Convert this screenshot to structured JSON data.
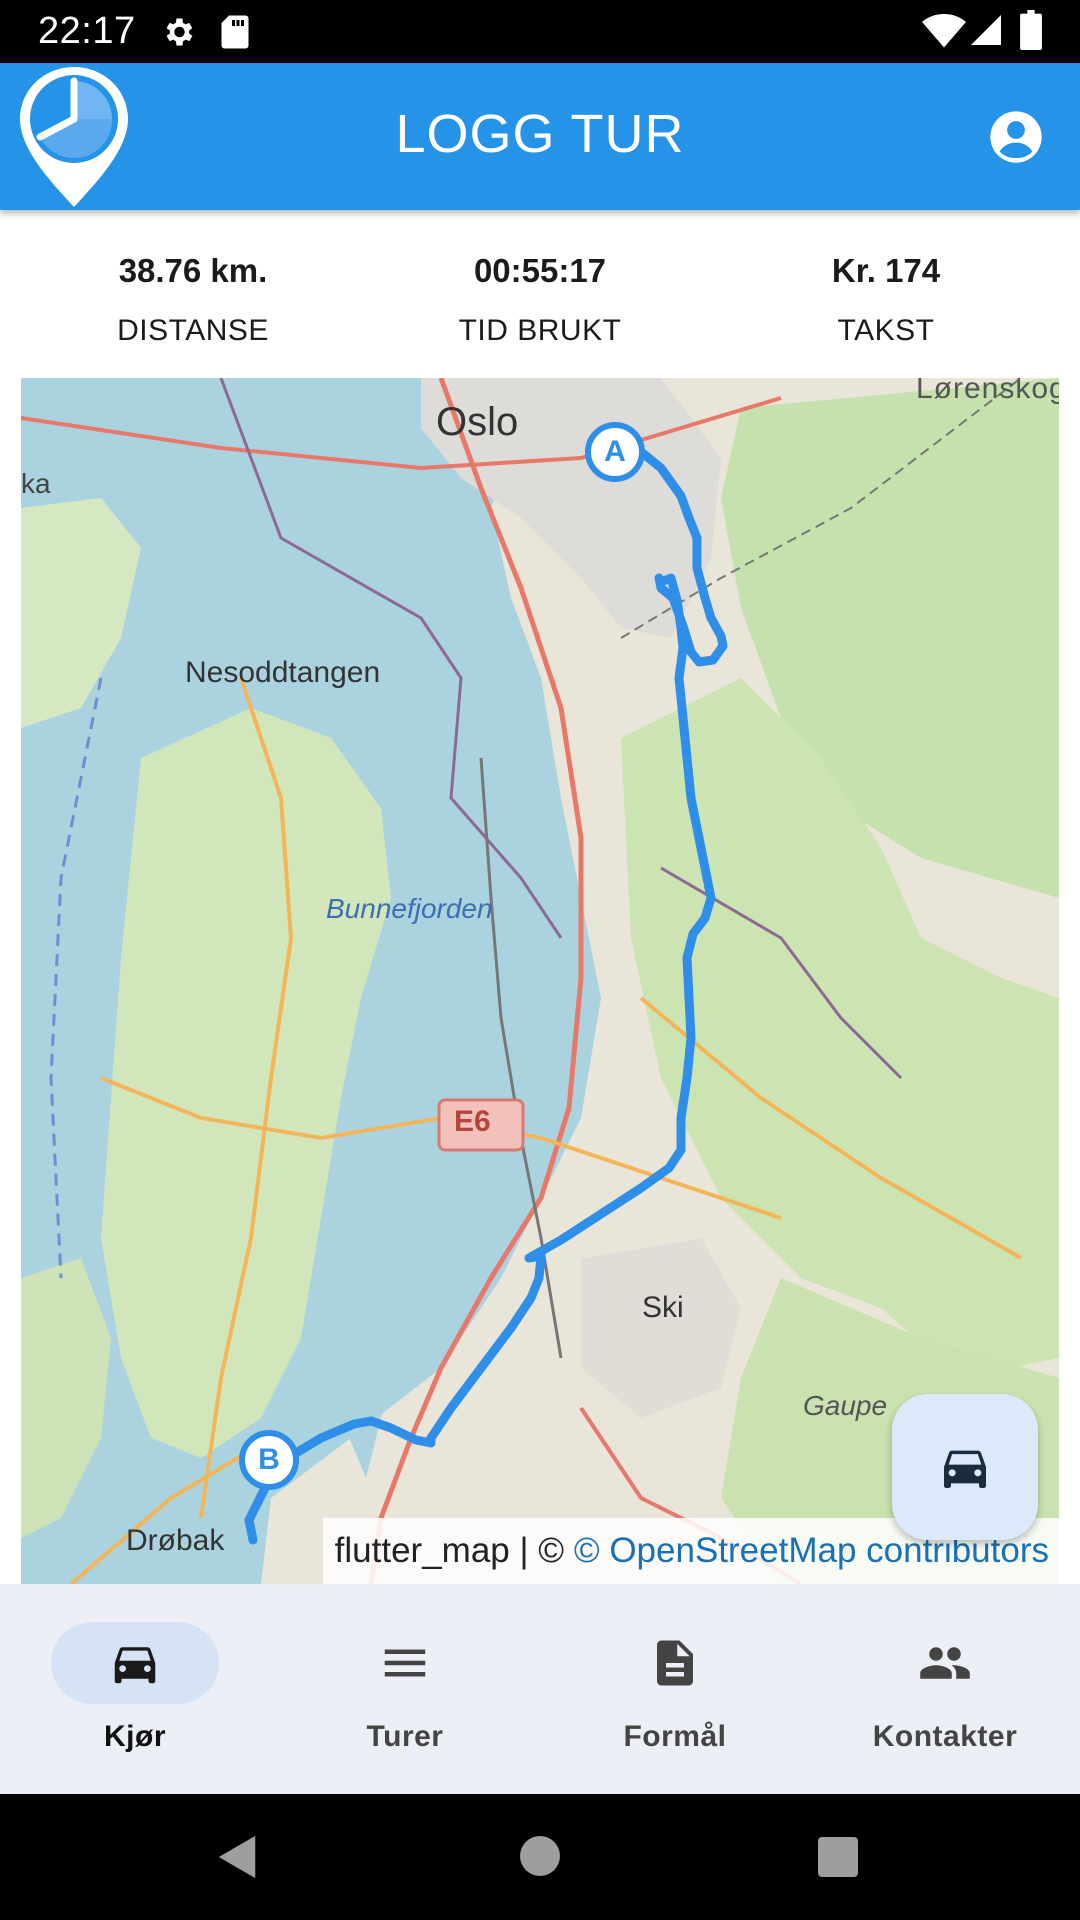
{
  "status_bar": {
    "time": "22:17",
    "icons": [
      "settings-icon",
      "sd-card-icon",
      "wifi-icon",
      "signal-icon",
      "battery-icon"
    ]
  },
  "app_bar": {
    "title": "LOGG TUR",
    "logo_icon": "clock-pin-logo",
    "account_icon": "account-circle-icon",
    "color": "#2493e8"
  },
  "stats": {
    "distance": {
      "value": "38.76 km.",
      "label": "DISTANSE"
    },
    "time": {
      "value": "00:55:17",
      "label": "TID BRUKT"
    },
    "fare": {
      "value": "Kr. 174",
      "label": "TAKST"
    }
  },
  "map": {
    "labels": {
      "oslo": "Oslo",
      "lorenskog": "Lørenskog",
      "ka": "ka",
      "nesoddtangen": "Nesoddtangen",
      "bunnefjorden": "Bunnefjorden",
      "ski": "Ski",
      "gaupe": "Gaupe",
      "drobak": "Drøbak",
      "e6": "E6"
    },
    "markers": {
      "start": "A",
      "end": "B"
    },
    "route_color": "#2f8fe8",
    "attribution_prefix": "flutter_map | © ",
    "attribution_link": "© OpenStreetMap contributors"
  },
  "fab": {
    "icon": "car-icon"
  },
  "bottom_nav": [
    {
      "label": "Kjør",
      "icon": "car-icon",
      "active": true
    },
    {
      "label": "Turer",
      "icon": "menu-icon",
      "active": false
    },
    {
      "label": "Formål",
      "icon": "document-icon",
      "active": false
    },
    {
      "label": "Kontakter",
      "icon": "people-icon",
      "active": false
    }
  ],
  "system_nav": [
    "back-icon",
    "home-icon",
    "recents-icon"
  ]
}
